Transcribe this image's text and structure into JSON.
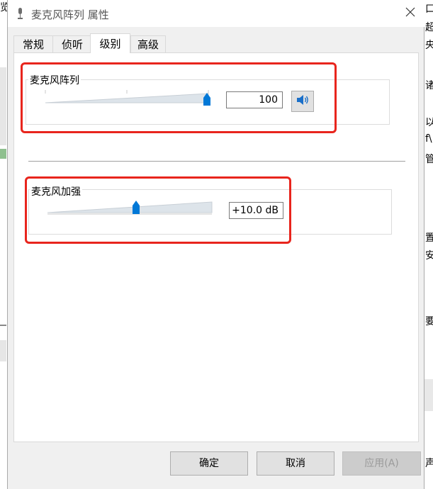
{
  "background": {
    "left_fragment": "览",
    "right_fragments": [
      "口",
      "超",
      "央",
      "诸",
      "以",
      "f\\",
      "管",
      "置",
      "安",
      "要",
      "声"
    ]
  },
  "dialog": {
    "title": "麦克风阵列 属性",
    "tabs": [
      {
        "label": "常规",
        "active": false
      },
      {
        "label": "侦听",
        "active": false
      },
      {
        "label": "级别",
        "active": true
      },
      {
        "label": "高级",
        "active": false
      }
    ],
    "levels": {
      "mic_array": {
        "label": "麦克风阵列",
        "value": "100",
        "level": 1.0
      },
      "mic_boost": {
        "label": "麦克风加强",
        "value": "+10.0 dB",
        "level": 0.5
      }
    },
    "buttons": {
      "ok": "确定",
      "cancel": "取消",
      "apply": "应用(A)"
    }
  },
  "colors": {
    "highlight": "#e8251d",
    "thumb": "#0078d7"
  }
}
